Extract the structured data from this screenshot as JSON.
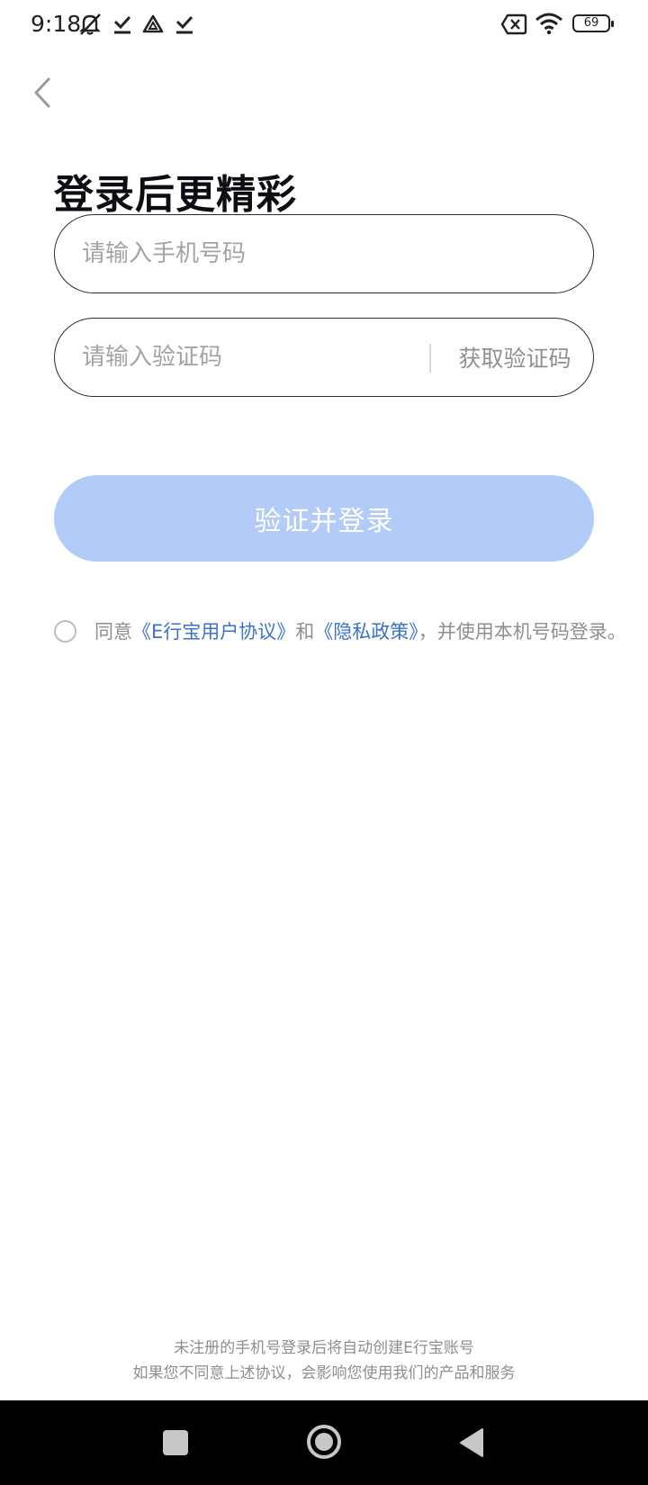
{
  "status_bar": {
    "time": "9:18",
    "battery": "69",
    "left_icons": [
      "bell-muted-icon",
      "check-download-icon",
      "drive-icon",
      "check-download-icon"
    ],
    "right_icons": [
      "no-sim-icon",
      "wifi-icon",
      "battery-icon"
    ]
  },
  "login": {
    "title": "登录后更精彩",
    "phone_placeholder": "请输入手机号码",
    "code_placeholder": "请输入验证码",
    "get_code_label": "获取验证码",
    "submit_label": "验证并登录"
  },
  "agreement": {
    "prefix": "同意",
    "user_agreement": "《E行宝用户协议》",
    "and": "和",
    "privacy_policy": "《隐私政策》",
    "suffix": "，并使用本机号码登录。"
  },
  "footer": {
    "line1": "未注册的手机号登录后将自动创建E行宝账号",
    "line2": "如果您不同意上述协议，会影响您使用我们的产品和服务"
  },
  "colors": {
    "accent_link": "#3a73c8",
    "button_disabled": "#b2cbf7",
    "placeholder": "#a3a3a8"
  }
}
